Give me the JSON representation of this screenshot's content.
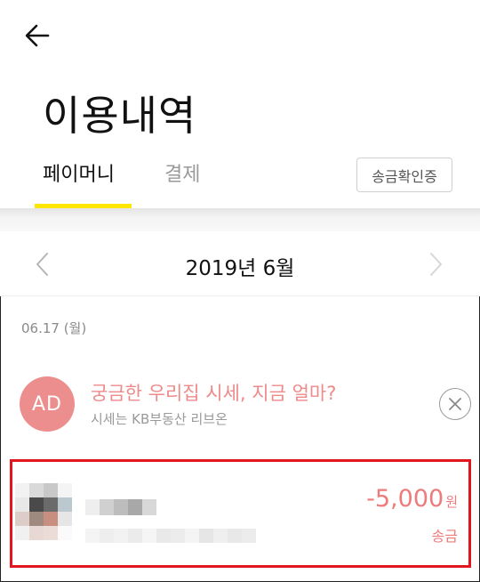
{
  "header": {
    "title": "이용내역",
    "tabs": [
      {
        "label": "페이머니",
        "active": true
      },
      {
        "label": "결제",
        "active": false
      }
    ],
    "verify_button": "송금확인증",
    "back_icon": "arrow-left-icon"
  },
  "month": {
    "label": "2019년 6월",
    "prev_icon": "chevron-left-icon",
    "next_icon": "chevron-right-icon"
  },
  "date_header": "06.17 (월)",
  "ad": {
    "badge": "AD",
    "title": "궁금한 우리집 시세, 지금 얼마?",
    "subtitle": "시세는 KB부동산 리브온",
    "close_icon": "close-circle-icon"
  },
  "transaction": {
    "amount": "-5,000",
    "currency": "원",
    "type": "송금"
  },
  "colors": {
    "accent_yellow": "#ffe600",
    "ad_pink": "#ec8e8e",
    "amount_red": "#ee7b7b",
    "highlight_red": "#e2161f"
  }
}
